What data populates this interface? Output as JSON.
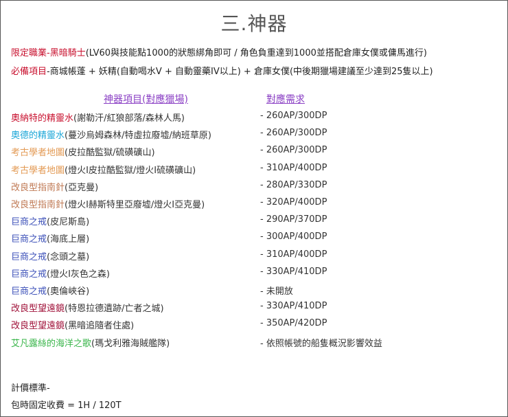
{
  "title": "三.神器",
  "limit": {
    "label": "限定職業",
    "sep": "-",
    "class_name": "黑暗騎士",
    "text": "(LV60與技能點1000的狀態綁角即可 / 角色負重達到1000並搭配倉庫女僕或傭馬進行)"
  },
  "required": {
    "label": "必備項目",
    "text": "-商城帳蓬 + 妖精(自動喝水V + 自動靈藥IV以上) + 倉庫女僕(中後期獵場建議至少達到25隻以上)"
  },
  "table": {
    "col_item": "神器項目(對應獵場)",
    "col_req": "對應需求",
    "rows": [
      {
        "name": "奧納特的精靈水",
        "desc": "(謝勒汗/紅狼部落/森林人馬)",
        "req": "- 260AP/300DP",
        "color": "#c8102e"
      },
      {
        "name": "奧德的精靈水",
        "desc": "(蔓沙烏姆森林/特虛拉廢墟/納班草原)",
        "req": "- 260AP/300DP",
        "color": "#1ea7d8"
      },
      {
        "name": "考古學者地圖",
        "desc": "(皮拉酷監獄/硫磺礦山)",
        "req": "- 260AP/300DP",
        "color": "#e39a54"
      },
      {
        "name": "考古學者地圖",
        "desc": "(燈火I皮拉酷監獄/燈火I硫磺礦山)",
        "req": "- 310AP/400DP",
        "color": "#e39a54"
      },
      {
        "name": "改良型指南針",
        "desc": "(亞克曼)",
        "req": "- 280AP/330DP",
        "color": "#c07a55"
      },
      {
        "name": "改良型指南針",
        "desc": "(燈火I赫斯特里亞廢墟/燈火I亞克曼)",
        "req": "- 320AP/400DP",
        "color": "#c07a55"
      },
      {
        "name": "巨商之戒",
        "desc": "(皮尼斯島)",
        "req": "- 290AP/370DP",
        "color": "#3b4fb8"
      },
      {
        "name": "巨商之戒",
        "desc": "(海底上層)",
        "req": "- 300AP/400DP",
        "color": "#3b4fb8"
      },
      {
        "name": "巨商之戒",
        "desc": "(念頭之墓)",
        "req": "- 310AP/400DP",
        "color": "#3b4fb8"
      },
      {
        "name": "巨商之戒",
        "desc": "(燈火I灰色之森)",
        "req": "- 330AP/410DP",
        "color": "#3b4fb8"
      },
      {
        "name": "巨商之戒",
        "desc": "(奧倫峽谷)",
        "req": "- 未開放",
        "color": "#3b4fb8"
      },
      {
        "name": "改良型望遠鏡",
        "desc": "(特恩拉德遺跡/亡者之城)",
        "req": "- 330AP/410DP",
        "color": "#a0123a"
      },
      {
        "name": "改良型望遠鏡",
        "desc": "(黑暗追隨者住處)",
        "req": "- 350AP/420DP",
        "color": "#a0123a"
      },
      {
        "name": "艾凡露絲的海洋之歌",
        "desc": "(瑪戈利雅海賊艦隊)",
        "req": "- 依照帳號的船隻概況影響效益",
        "color": "#39b54a"
      }
    ]
  },
  "pricing": {
    "label": "計價標準-",
    "text": "包時固定收費 = 1H / 120T"
  }
}
